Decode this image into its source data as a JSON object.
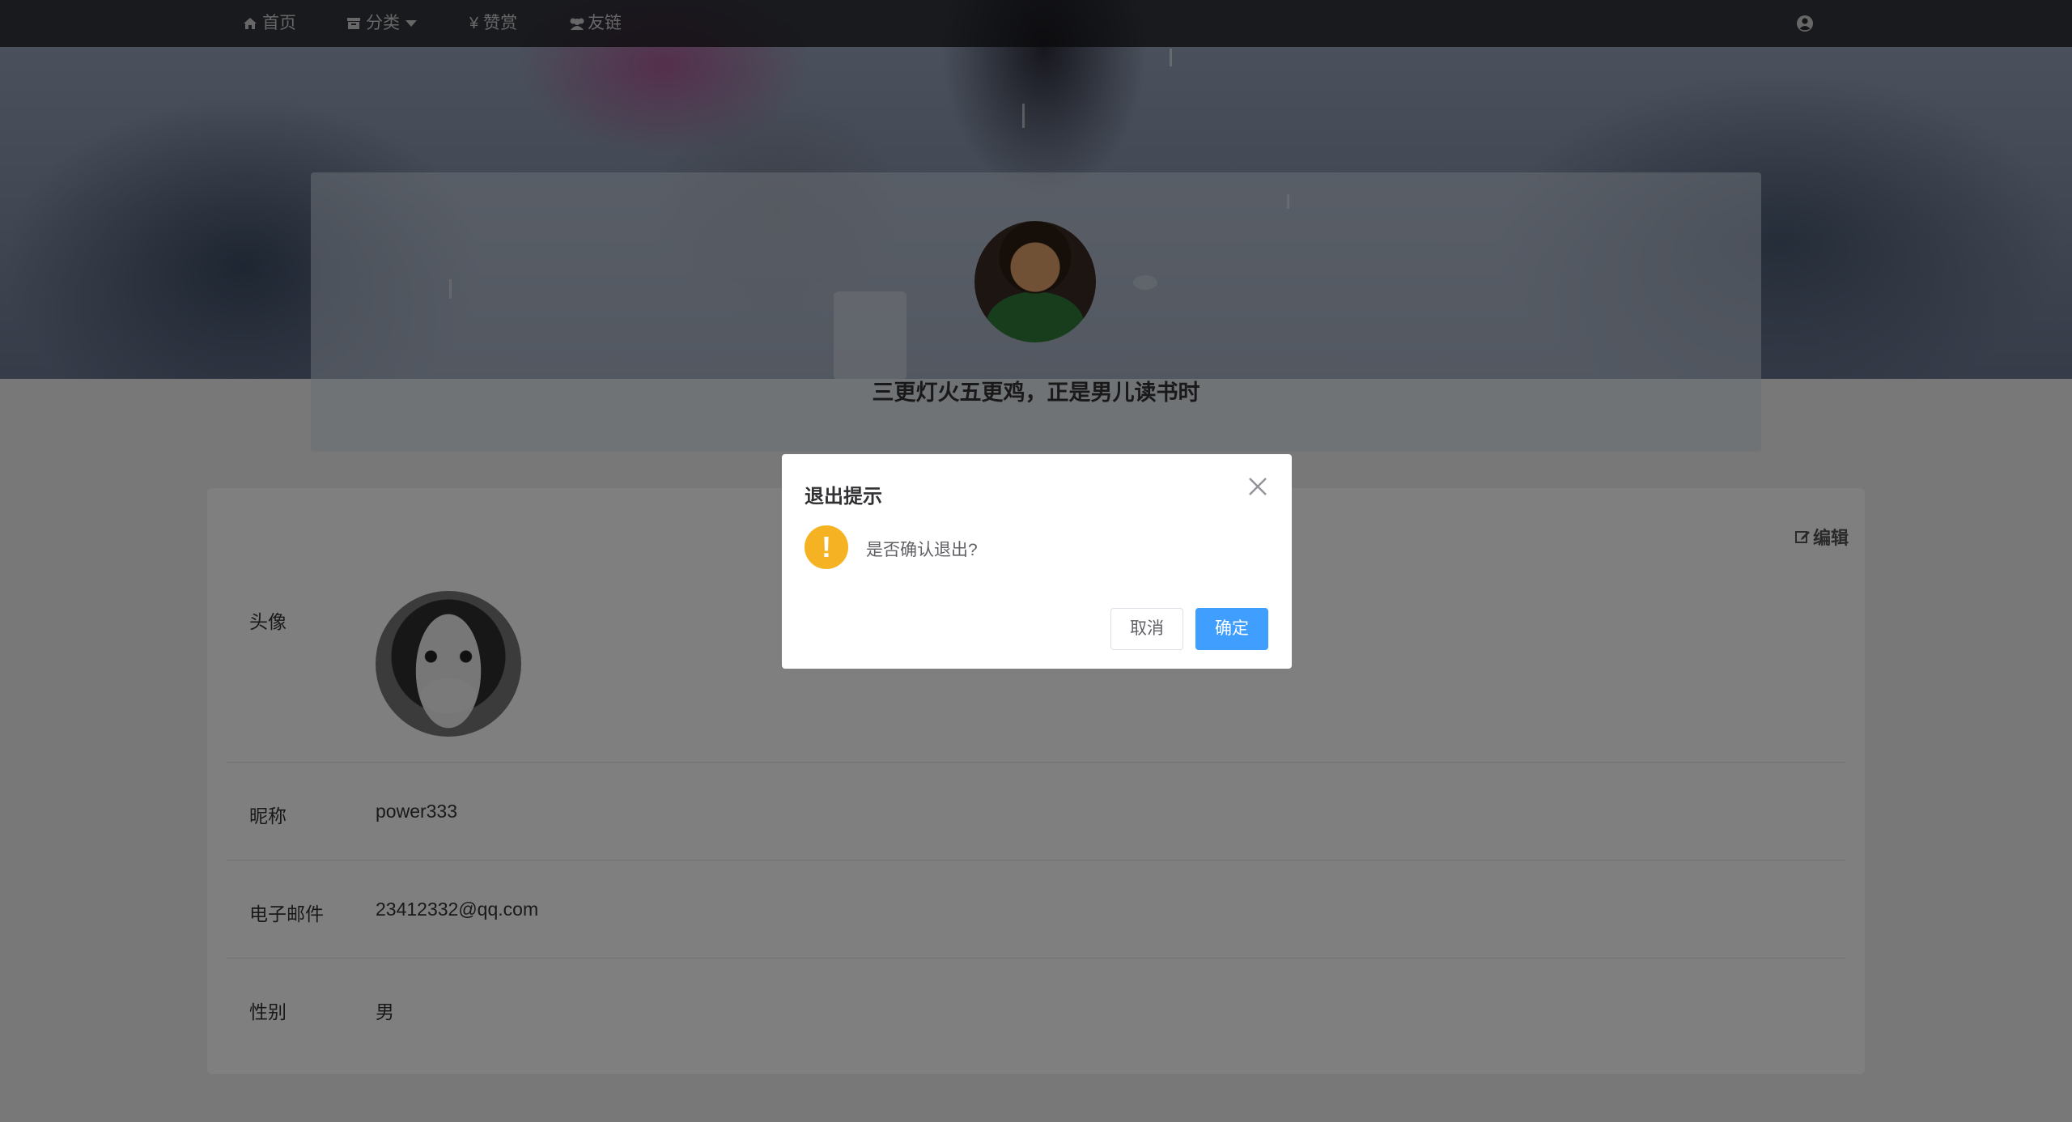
{
  "nav": {
    "home": "首页",
    "category": "分类",
    "reward": "赞赏",
    "friends": "友链"
  },
  "banner": {
    "motto": "三更灯火五更鸡，正是男儿读书时"
  },
  "profile": {
    "edit_label": "编辑",
    "avatar_label": "头像",
    "nickname_label": "昵称",
    "nickname_value": "power333",
    "email_label": "电子邮件",
    "email_value": "23412332@qq.com",
    "gender_label": "性别",
    "gender_value": "男"
  },
  "dialog": {
    "title": "退出提示",
    "message": "是否确认退出?",
    "cancel": "取消",
    "confirm": "确定",
    "warning_symbol": "!"
  },
  "colors": {
    "primary": "#409eff",
    "warning": "#f5b323"
  }
}
